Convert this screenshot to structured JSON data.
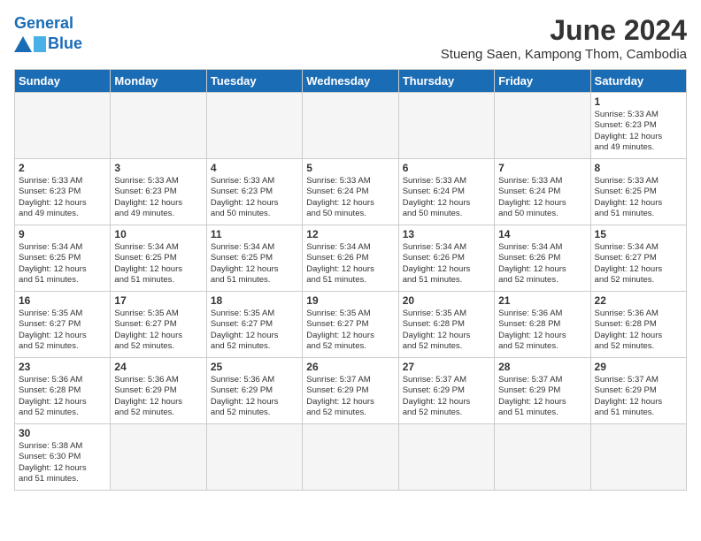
{
  "header": {
    "logo_general": "General",
    "logo_blue": "Blue",
    "main_title": "June 2024",
    "subtitle": "Stueng Saen, Kampong Thom, Cambodia"
  },
  "days_of_week": [
    "Sunday",
    "Monday",
    "Tuesday",
    "Wednesday",
    "Thursday",
    "Friday",
    "Saturday"
  ],
  "weeks": [
    {
      "days": [
        {
          "number": "",
          "info": "",
          "empty": true
        },
        {
          "number": "",
          "info": "",
          "empty": true
        },
        {
          "number": "",
          "info": "",
          "empty": true
        },
        {
          "number": "",
          "info": "",
          "empty": true
        },
        {
          "number": "",
          "info": "",
          "empty": true
        },
        {
          "number": "",
          "info": "",
          "empty": true
        },
        {
          "number": "1",
          "info": "Sunrise: 5:33 AM\nSunset: 6:23 PM\nDaylight: 12 hours\nand 49 minutes.",
          "empty": false
        }
      ]
    },
    {
      "days": [
        {
          "number": "2",
          "info": "Sunrise: 5:33 AM\nSunset: 6:23 PM\nDaylight: 12 hours\nand 49 minutes.",
          "empty": false
        },
        {
          "number": "3",
          "info": "Sunrise: 5:33 AM\nSunset: 6:23 PM\nDaylight: 12 hours\nand 49 minutes.",
          "empty": false
        },
        {
          "number": "4",
          "info": "Sunrise: 5:33 AM\nSunset: 6:23 PM\nDaylight: 12 hours\nand 50 minutes.",
          "empty": false
        },
        {
          "number": "5",
          "info": "Sunrise: 5:33 AM\nSunset: 6:24 PM\nDaylight: 12 hours\nand 50 minutes.",
          "empty": false
        },
        {
          "number": "6",
          "info": "Sunrise: 5:33 AM\nSunset: 6:24 PM\nDaylight: 12 hours\nand 50 minutes.",
          "empty": false
        },
        {
          "number": "7",
          "info": "Sunrise: 5:33 AM\nSunset: 6:24 PM\nDaylight: 12 hours\nand 50 minutes.",
          "empty": false
        },
        {
          "number": "8",
          "info": "Sunrise: 5:33 AM\nSunset: 6:25 PM\nDaylight: 12 hours\nand 51 minutes.",
          "empty": false
        }
      ]
    },
    {
      "days": [
        {
          "number": "9",
          "info": "Sunrise: 5:34 AM\nSunset: 6:25 PM\nDaylight: 12 hours\nand 51 minutes.",
          "empty": false
        },
        {
          "number": "10",
          "info": "Sunrise: 5:34 AM\nSunset: 6:25 PM\nDaylight: 12 hours\nand 51 minutes.",
          "empty": false
        },
        {
          "number": "11",
          "info": "Sunrise: 5:34 AM\nSunset: 6:25 PM\nDaylight: 12 hours\nand 51 minutes.",
          "empty": false
        },
        {
          "number": "12",
          "info": "Sunrise: 5:34 AM\nSunset: 6:26 PM\nDaylight: 12 hours\nand 51 minutes.",
          "empty": false
        },
        {
          "number": "13",
          "info": "Sunrise: 5:34 AM\nSunset: 6:26 PM\nDaylight: 12 hours\nand 51 minutes.",
          "empty": false
        },
        {
          "number": "14",
          "info": "Sunrise: 5:34 AM\nSunset: 6:26 PM\nDaylight: 12 hours\nand 52 minutes.",
          "empty": false
        },
        {
          "number": "15",
          "info": "Sunrise: 5:34 AM\nSunset: 6:27 PM\nDaylight: 12 hours\nand 52 minutes.",
          "empty": false
        }
      ]
    },
    {
      "days": [
        {
          "number": "16",
          "info": "Sunrise: 5:35 AM\nSunset: 6:27 PM\nDaylight: 12 hours\nand 52 minutes.",
          "empty": false
        },
        {
          "number": "17",
          "info": "Sunrise: 5:35 AM\nSunset: 6:27 PM\nDaylight: 12 hours\nand 52 minutes.",
          "empty": false
        },
        {
          "number": "18",
          "info": "Sunrise: 5:35 AM\nSunset: 6:27 PM\nDaylight: 12 hours\nand 52 minutes.",
          "empty": false
        },
        {
          "number": "19",
          "info": "Sunrise: 5:35 AM\nSunset: 6:27 PM\nDaylight: 12 hours\nand 52 minutes.",
          "empty": false
        },
        {
          "number": "20",
          "info": "Sunrise: 5:35 AM\nSunset: 6:28 PM\nDaylight: 12 hours\nand 52 minutes.",
          "empty": false
        },
        {
          "number": "21",
          "info": "Sunrise: 5:36 AM\nSunset: 6:28 PM\nDaylight: 12 hours\nand 52 minutes.",
          "empty": false
        },
        {
          "number": "22",
          "info": "Sunrise: 5:36 AM\nSunset: 6:28 PM\nDaylight: 12 hours\nand 52 minutes.",
          "empty": false
        }
      ]
    },
    {
      "days": [
        {
          "number": "23",
          "info": "Sunrise: 5:36 AM\nSunset: 6:28 PM\nDaylight: 12 hours\nand 52 minutes.",
          "empty": false
        },
        {
          "number": "24",
          "info": "Sunrise: 5:36 AM\nSunset: 6:29 PM\nDaylight: 12 hours\nand 52 minutes.",
          "empty": false
        },
        {
          "number": "25",
          "info": "Sunrise: 5:36 AM\nSunset: 6:29 PM\nDaylight: 12 hours\nand 52 minutes.",
          "empty": false
        },
        {
          "number": "26",
          "info": "Sunrise: 5:37 AM\nSunset: 6:29 PM\nDaylight: 12 hours\nand 52 minutes.",
          "empty": false
        },
        {
          "number": "27",
          "info": "Sunrise: 5:37 AM\nSunset: 6:29 PM\nDaylight: 12 hours\nand 52 minutes.",
          "empty": false
        },
        {
          "number": "28",
          "info": "Sunrise: 5:37 AM\nSunset: 6:29 PM\nDaylight: 12 hours\nand 51 minutes.",
          "empty": false
        },
        {
          "number": "29",
          "info": "Sunrise: 5:37 AM\nSunset: 6:29 PM\nDaylight: 12 hours\nand 51 minutes.",
          "empty": false
        }
      ]
    },
    {
      "days": [
        {
          "number": "30",
          "info": "Sunrise: 5:38 AM\nSunset: 6:30 PM\nDaylight: 12 hours\nand 51 minutes.",
          "empty": false
        },
        {
          "number": "",
          "info": "",
          "empty": true
        },
        {
          "number": "",
          "info": "",
          "empty": true
        },
        {
          "number": "",
          "info": "",
          "empty": true
        },
        {
          "number": "",
          "info": "",
          "empty": true
        },
        {
          "number": "",
          "info": "",
          "empty": true
        },
        {
          "number": "",
          "info": "",
          "empty": true
        }
      ]
    }
  ]
}
